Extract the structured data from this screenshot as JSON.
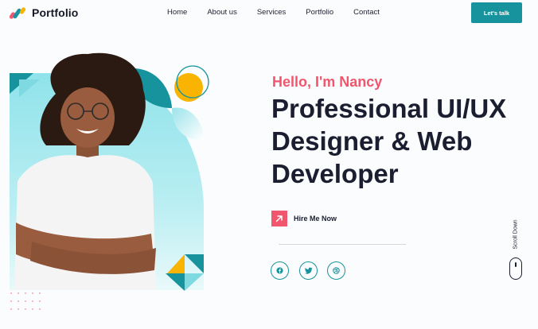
{
  "header": {
    "logo_text": "Portfolio",
    "nav": [
      "Home",
      "About us",
      "Services",
      "Portfolio",
      "Contact"
    ],
    "cta_label": "Let's talk"
  },
  "hero": {
    "greeting": "Hello, I'm Nancy",
    "headline": "Professional UI/UX Designer & Web Developer",
    "hire_label": "Hire Me Now",
    "social_icons": [
      "facebook-icon",
      "twitter-icon",
      "dribbble-icon"
    ],
    "scroll_label": "Scroll Down"
  },
  "colors": {
    "accent_teal": "#17939e",
    "accent_pink": "#f0566e",
    "accent_yellow": "#f8b400",
    "light_teal": "#6fd8e2",
    "text_dark": "#1b1e30"
  }
}
